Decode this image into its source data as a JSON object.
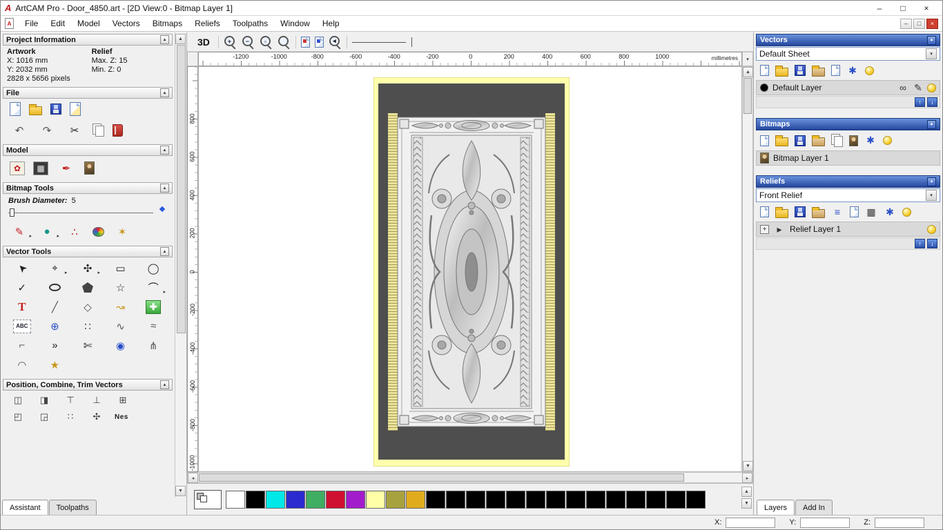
{
  "titlebar": {
    "title": "ArtCAM Pro - Door_4850.art - [2D View:0 - Bitmap Layer 1]"
  },
  "menubar": {
    "items": [
      "File",
      "Edit",
      "Model",
      "Vectors",
      "Bitmaps",
      "Reliefs",
      "Toolpaths",
      "Window",
      "Help"
    ]
  },
  "assistant": {
    "project_header": "Project Information",
    "artwork_title": "Artwork",
    "relief_title": "Relief",
    "artwork_x": "X: 1016 mm",
    "artwork_y": "Y: 2032 mm",
    "relief_max": "Max. Z: 15",
    "relief_min": "Min. Z: 0",
    "artwork_pixels": "2828 x 5656 pixels",
    "file_header": "File",
    "model_header": "Model",
    "bitmap_header": "Bitmap Tools",
    "brush_label": "Brush Diameter:",
    "brush_value": "5",
    "vector_header": "Vector Tools",
    "position_header": "Position, Combine, Trim Vectors",
    "nesting_label": "Nes",
    "tab_assistant": "Assistant",
    "tab_toolpaths": "Toolpaths"
  },
  "canvas": {
    "view3d": "3D",
    "units": "millimetres",
    "ruler_h": [
      "-1200",
      "-1000",
      "-800",
      "-600",
      "-400",
      "-200",
      "0",
      "200",
      "400",
      "600",
      "800",
      "1000"
    ],
    "ruler_v": [
      "800",
      "600",
      "400",
      "200",
      "0",
      "-200",
      "-400",
      "-600",
      "-800",
      "-1000"
    ]
  },
  "palette": {
    "colors": [
      "#ffffff",
      "#000000",
      "#00e8e8",
      "#2b2bd0",
      "#3fae62",
      "#d01030",
      "#a31ccc",
      "#ffffa8",
      "#a8a23e",
      "#e0ac1e",
      "#000000",
      "#000000",
      "#000000",
      "#000000",
      "#000000",
      "#000000",
      "#000000",
      "#000000",
      "#000000",
      "#000000",
      "#000000",
      "#000000",
      "#000000",
      "#000000"
    ]
  },
  "layers": {
    "vectors_header": "Vectors",
    "sheet_value": "Default Sheet",
    "vector_layer": "Default Layer",
    "bitmaps_header": "Bitmaps",
    "bitmap_layer": "Bitmap Layer 1",
    "reliefs_header": "Reliefs",
    "relief_value": "Front Relief",
    "relief_layer": "Relief Layer 1",
    "tab_layers": "Layers",
    "tab_addin": "Add In"
  },
  "statusbar": {
    "x_label": "X:",
    "y_label": "Y:",
    "z_label": "Z:"
  },
  "glyphs": {
    "logo": "A",
    "doc": "A",
    "min": "–",
    "max": "□",
    "close": "×",
    "collapse": "▲",
    "dropdown": "▾",
    "scroll_up": "▲",
    "scroll_down": "▼",
    "scroll_left": "◂",
    "scroll_right": "▸",
    "undo": "↶",
    "redo": "↷",
    "cut": "✂",
    "model_greyscale": "✿",
    "model_size": "▦",
    "model_texture": "✒",
    "paint_pencil": "✎",
    "paint_blob": "●",
    "paint_scatter": "∴",
    "flood_fill": "✶",
    "flyout": "▸",
    "select": "➤",
    "transform": "⌖",
    "move": "✣",
    "rect": "▭",
    "circle": "◯",
    "polyline": "✓",
    "star": "☆",
    "arc": "⌒",
    "text": "T",
    "measure": "╱",
    "offset": "◇",
    "distort": "↝",
    "block_plus": "✚",
    "abc": "ABC",
    "sphere": "⊕",
    "array": "∷",
    "node": "∿",
    "fit": "≈",
    "fillet": "⌐",
    "join": "»",
    "trim": "✄",
    "spiral": "◉",
    "fork": "⋔",
    "bridge": "◠",
    "wrapstar": "★",
    "align1": "◫",
    "align2": "◨",
    "align3": "⊤",
    "align4": "⊥",
    "align5": "⊞",
    "align6": "◰",
    "align7": "◲",
    "align8": "∷",
    "align9": "✣",
    "zoom_plus": "+",
    "zoom_minus": "−",
    "zoom_rect": "▫",
    "zoom_prev": "◂",
    "blue_star": "✱",
    "stack": "≡",
    "grid": "▦",
    "link": "∞",
    "edit_pencil": "✎",
    "arrow_right": "▸",
    "plus": "+",
    "up": "↑",
    "down": "↓"
  },
  "icon_shapes": {
    "new-model-icon": "css-page",
    "open-model-icon": "css-folder",
    "save-model-icon": "css-disk",
    "import-image-icon": "css-page-alt",
    "copy-paste-icon": "css-double-page",
    "notes-icon": "css-red-book",
    "bitmap-from-relief-icon": "css-mona-tile",
    "visibility-bulb-icon": "css-yellow-bulb",
    "colour-palette-icon": "css-conic-palette",
    "zoom-icons": "css-magnifier",
    "primary-colour-chip": "css-overlap-squares"
  }
}
